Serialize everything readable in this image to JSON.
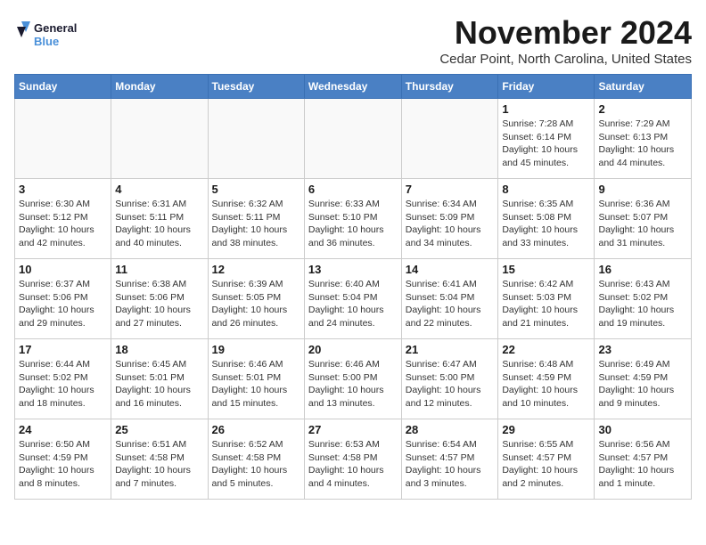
{
  "header": {
    "logo_line1": "General",
    "logo_line2": "Blue",
    "month": "November 2024",
    "location": "Cedar Point, North Carolina, United States"
  },
  "weekdays": [
    "Sunday",
    "Monday",
    "Tuesday",
    "Wednesday",
    "Thursday",
    "Friday",
    "Saturday"
  ],
  "weeks": [
    [
      {
        "day": "",
        "info": ""
      },
      {
        "day": "",
        "info": ""
      },
      {
        "day": "",
        "info": ""
      },
      {
        "day": "",
        "info": ""
      },
      {
        "day": "",
        "info": ""
      },
      {
        "day": "1",
        "info": "Sunrise: 7:28 AM\nSunset: 6:14 PM\nDaylight: 10 hours and 45 minutes."
      },
      {
        "day": "2",
        "info": "Sunrise: 7:29 AM\nSunset: 6:13 PM\nDaylight: 10 hours and 44 minutes."
      }
    ],
    [
      {
        "day": "3",
        "info": "Sunrise: 6:30 AM\nSunset: 5:12 PM\nDaylight: 10 hours and 42 minutes."
      },
      {
        "day": "4",
        "info": "Sunrise: 6:31 AM\nSunset: 5:11 PM\nDaylight: 10 hours and 40 minutes."
      },
      {
        "day": "5",
        "info": "Sunrise: 6:32 AM\nSunset: 5:11 PM\nDaylight: 10 hours and 38 minutes."
      },
      {
        "day": "6",
        "info": "Sunrise: 6:33 AM\nSunset: 5:10 PM\nDaylight: 10 hours and 36 minutes."
      },
      {
        "day": "7",
        "info": "Sunrise: 6:34 AM\nSunset: 5:09 PM\nDaylight: 10 hours and 34 minutes."
      },
      {
        "day": "8",
        "info": "Sunrise: 6:35 AM\nSunset: 5:08 PM\nDaylight: 10 hours and 33 minutes."
      },
      {
        "day": "9",
        "info": "Sunrise: 6:36 AM\nSunset: 5:07 PM\nDaylight: 10 hours and 31 minutes."
      }
    ],
    [
      {
        "day": "10",
        "info": "Sunrise: 6:37 AM\nSunset: 5:06 PM\nDaylight: 10 hours and 29 minutes."
      },
      {
        "day": "11",
        "info": "Sunrise: 6:38 AM\nSunset: 5:06 PM\nDaylight: 10 hours and 27 minutes."
      },
      {
        "day": "12",
        "info": "Sunrise: 6:39 AM\nSunset: 5:05 PM\nDaylight: 10 hours and 26 minutes."
      },
      {
        "day": "13",
        "info": "Sunrise: 6:40 AM\nSunset: 5:04 PM\nDaylight: 10 hours and 24 minutes."
      },
      {
        "day": "14",
        "info": "Sunrise: 6:41 AM\nSunset: 5:04 PM\nDaylight: 10 hours and 22 minutes."
      },
      {
        "day": "15",
        "info": "Sunrise: 6:42 AM\nSunset: 5:03 PM\nDaylight: 10 hours and 21 minutes."
      },
      {
        "day": "16",
        "info": "Sunrise: 6:43 AM\nSunset: 5:02 PM\nDaylight: 10 hours and 19 minutes."
      }
    ],
    [
      {
        "day": "17",
        "info": "Sunrise: 6:44 AM\nSunset: 5:02 PM\nDaylight: 10 hours and 18 minutes."
      },
      {
        "day": "18",
        "info": "Sunrise: 6:45 AM\nSunset: 5:01 PM\nDaylight: 10 hours and 16 minutes."
      },
      {
        "day": "19",
        "info": "Sunrise: 6:46 AM\nSunset: 5:01 PM\nDaylight: 10 hours and 15 minutes."
      },
      {
        "day": "20",
        "info": "Sunrise: 6:46 AM\nSunset: 5:00 PM\nDaylight: 10 hours and 13 minutes."
      },
      {
        "day": "21",
        "info": "Sunrise: 6:47 AM\nSunset: 5:00 PM\nDaylight: 10 hours and 12 minutes."
      },
      {
        "day": "22",
        "info": "Sunrise: 6:48 AM\nSunset: 4:59 PM\nDaylight: 10 hours and 10 minutes."
      },
      {
        "day": "23",
        "info": "Sunrise: 6:49 AM\nSunset: 4:59 PM\nDaylight: 10 hours and 9 minutes."
      }
    ],
    [
      {
        "day": "24",
        "info": "Sunrise: 6:50 AM\nSunset: 4:59 PM\nDaylight: 10 hours and 8 minutes."
      },
      {
        "day": "25",
        "info": "Sunrise: 6:51 AM\nSunset: 4:58 PM\nDaylight: 10 hours and 7 minutes."
      },
      {
        "day": "26",
        "info": "Sunrise: 6:52 AM\nSunset: 4:58 PM\nDaylight: 10 hours and 5 minutes."
      },
      {
        "day": "27",
        "info": "Sunrise: 6:53 AM\nSunset: 4:58 PM\nDaylight: 10 hours and 4 minutes."
      },
      {
        "day": "28",
        "info": "Sunrise: 6:54 AM\nSunset: 4:57 PM\nDaylight: 10 hours and 3 minutes."
      },
      {
        "day": "29",
        "info": "Sunrise: 6:55 AM\nSunset: 4:57 PM\nDaylight: 10 hours and 2 minutes."
      },
      {
        "day": "30",
        "info": "Sunrise: 6:56 AM\nSunset: 4:57 PM\nDaylight: 10 hours and 1 minute."
      }
    ]
  ]
}
